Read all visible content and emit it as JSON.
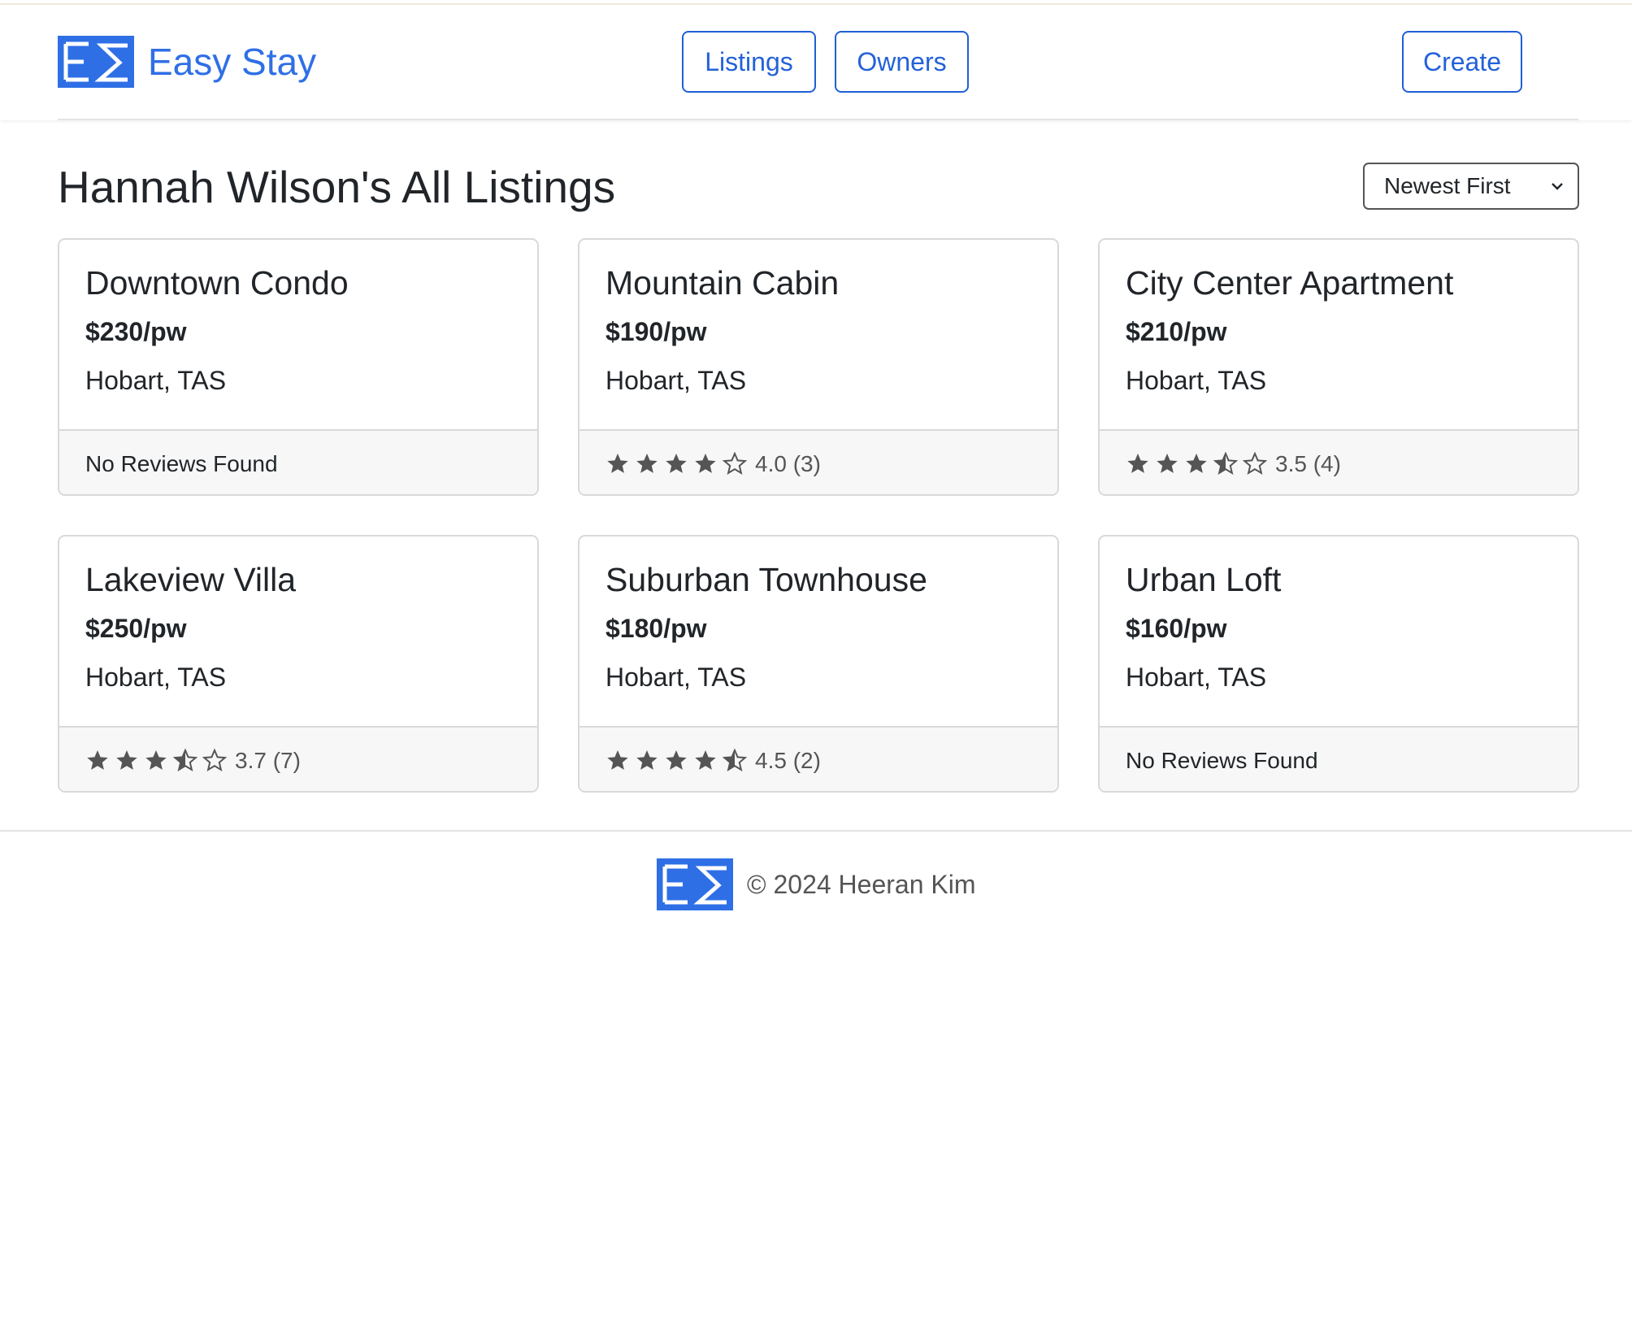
{
  "brand": {
    "name": "Easy Stay",
    "logo_icon": "easy-stay-logo-icon"
  },
  "nav": {
    "listings_label": "Listings",
    "owners_label": "Owners",
    "create_label": "Create"
  },
  "page": {
    "title": "Hannah Wilson's All Listings",
    "sort": {
      "selected": "Newest First"
    }
  },
  "listings": [
    {
      "title": "Downtown Condo",
      "price": "$230/pw",
      "location": "Hobart, TAS",
      "rating": null,
      "reviews_label": "No Reviews Found",
      "rating_text": ""
    },
    {
      "title": "Mountain Cabin",
      "price": "$190/pw",
      "location": "Hobart, TAS",
      "rating": 4.0,
      "reviews_label": "",
      "rating_text": "4.0 (3)"
    },
    {
      "title": "City Center Apartment",
      "price": "$210/pw",
      "location": "Hobart, TAS",
      "rating": 3.5,
      "reviews_label": "",
      "rating_text": "3.5 (4)"
    },
    {
      "title": "Lakeview Villa",
      "price": "$250/pw",
      "location": "Hobart, TAS",
      "rating": 3.7,
      "reviews_label": "",
      "rating_text": "3.7 (7)"
    },
    {
      "title": "Suburban Townhouse",
      "price": "$180/pw",
      "location": "Hobart, TAS",
      "rating": 4.5,
      "reviews_label": "",
      "rating_text": "4.5 (2)"
    },
    {
      "title": "Urban Loft",
      "price": "$160/pw",
      "location": "Hobart, TAS",
      "rating": null,
      "reviews_label": "No Reviews Found",
      "rating_text": ""
    }
  ],
  "footer": {
    "text": "© 2024 Heeran Kim"
  },
  "colors": {
    "brand_blue": "#2f6fe6",
    "button_border": "#1f5fd6",
    "star_gray": "#555555",
    "footer_bg": "#f7f7f7"
  }
}
